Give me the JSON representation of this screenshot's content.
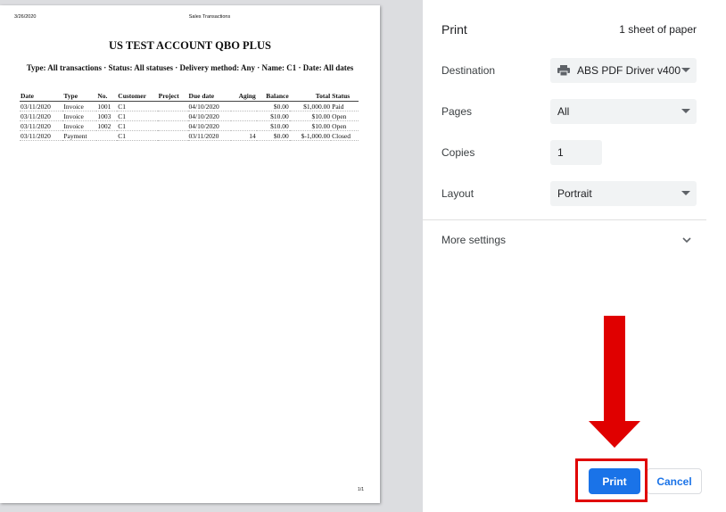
{
  "preview": {
    "page_date": "3/26/2020",
    "page_header": "Sales Transactions",
    "report_title": "US TEST ACCOUNT QBO PLUS",
    "report_subtitle": "Type: All transactions · Status: All statuses · Delivery method: Any · Name: C1 · Date: All dates",
    "columns": [
      "Date",
      "Type",
      "No.",
      "Customer",
      "Project",
      "Due date",
      "Aging",
      "Balance",
      "Total",
      "Status"
    ],
    "rows": [
      [
        "03/11/2020",
        "Invoice",
        "1001",
        "C1",
        "",
        "04/10/2020",
        "",
        "$0.00",
        "$1,000.00",
        "Paid"
      ],
      [
        "03/11/2020",
        "Invoice",
        "1003",
        "C1",
        "",
        "04/10/2020",
        "",
        "$10.00",
        "$10.00",
        "Open"
      ],
      [
        "03/11/2020",
        "Invoice",
        "1002",
        "C1",
        "",
        "04/10/2020",
        "",
        "$10.00",
        "$10.00",
        "Open"
      ],
      [
        "03/11/2020",
        "Payment",
        "",
        "C1",
        "",
        "03/11/2020",
        "14",
        "$0.00",
        "$-1,000.00",
        "Closed"
      ]
    ],
    "page_number": "1/1"
  },
  "settings": {
    "title": "Print",
    "sheet_info": "1 sheet of paper",
    "destination_label": "Destination",
    "destination_value": "ABS PDF Driver v400",
    "pages_label": "Pages",
    "pages_value": "All",
    "copies_label": "Copies",
    "copies_value": "1",
    "layout_label": "Layout",
    "layout_value": "Portrait",
    "more_settings_label": "More settings",
    "print_label": "Print",
    "cancel_label": "Cancel"
  },
  "colors": {
    "accent": "#1a73e8",
    "annotation": "#e00000"
  },
  "icons": [
    "printer-icon",
    "chevron-down-icon",
    "red-arrow-annotation"
  ]
}
